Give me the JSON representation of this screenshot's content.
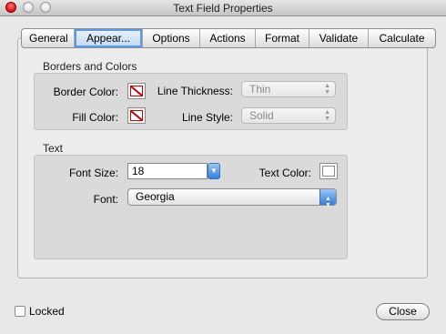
{
  "window": {
    "title": "Text Field Properties"
  },
  "tabs": [
    {
      "label": "General"
    },
    {
      "label": "Appear..."
    },
    {
      "label": "Options"
    },
    {
      "label": "Actions"
    },
    {
      "label": "Format"
    },
    {
      "label": "Validate"
    },
    {
      "label": "Calculate"
    }
  ],
  "selected_tab": "Appear...",
  "borders_colors": {
    "heading": "Borders and Colors",
    "border_color_label": "Border Color:",
    "fill_color_label": "Fill Color:",
    "line_thickness_label": "Line Thickness:",
    "line_thickness_value": "Thin",
    "line_style_label": "Line Style:",
    "line_style_value": "Solid"
  },
  "text": {
    "heading": "Text",
    "font_size_label": "Font Size:",
    "font_size_value": "18",
    "text_color_label": "Text Color:",
    "text_color": "#ffffff",
    "font_label": "Font:",
    "font_value": "Georgia"
  },
  "footer": {
    "locked_label": "Locked",
    "locked_checked": false,
    "close_label": "Close"
  },
  "colors": {
    "accent": "#5b9ae6",
    "no_color_slash": "#cc0000"
  }
}
